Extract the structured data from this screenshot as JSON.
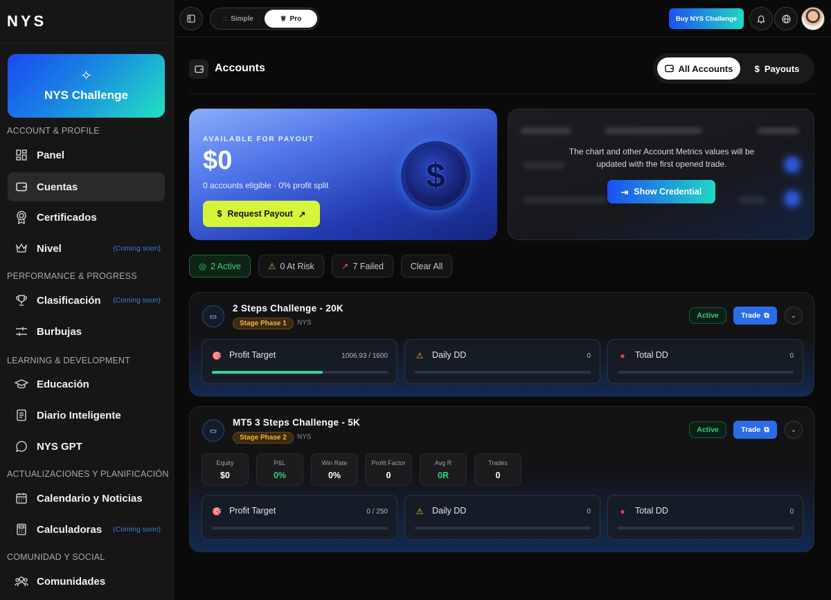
{
  "brand": {
    "logo": "NYS",
    "challenge_card": "NYS Challenge"
  },
  "sidebar": {
    "sections": [
      {
        "label": "ACCOUNT & PROFILE"
      },
      {
        "label": "PERFORMANCE & PROGRESS"
      },
      {
        "label": "LEARNING & DEVELOPMENT"
      },
      {
        "label": "ACTUALIZACIONES Y PLANIFICACIÓN"
      },
      {
        "label": "COMUNIDAD Y SOCIAL"
      }
    ],
    "items": [
      {
        "label": "Panel"
      },
      {
        "label": "Cuentas",
        "active": true
      },
      {
        "label": "Certificados"
      },
      {
        "label": "Nivel",
        "badge": "(Coming soon)"
      },
      {
        "label": "Clasificación",
        "badge": "(Coming soon)"
      },
      {
        "label": "Burbujas"
      },
      {
        "label": "Educación"
      },
      {
        "label": "Diario Inteligente"
      },
      {
        "label": "NYS GPT"
      },
      {
        "label": "Calendario y Noticias"
      },
      {
        "label": "Calculadoras",
        "badge": "(Coming soon)"
      },
      {
        "label": "Comunidades"
      }
    ]
  },
  "topbar": {
    "mode_simple": "Simple",
    "mode_pro": "Pro",
    "active_mode": "Pro",
    "buy_button": "Buy NYS Challenge"
  },
  "accounts_header": {
    "title": "Accounts",
    "tab_all": "All Accounts",
    "tab_payouts": "Payouts",
    "active_tab": "All Accounts"
  },
  "payout": {
    "kicker": "AVAILABLE FOR PAYOUT",
    "amount": "$0",
    "sub": "0 accounts eligible · 0% profit split",
    "button": "Request Payout"
  },
  "metrics_notice": {
    "message": "The chart and other Account Metrics values will be updated with the first opened trade.",
    "button": "Show Credential"
  },
  "filters": [
    {
      "label": "2 Active",
      "active": true
    },
    {
      "label": "0 At Risk"
    },
    {
      "label": "7 Failed"
    },
    {
      "label": "Clear All"
    }
  ],
  "accounts": [
    {
      "name": "2 Steps Challenge - 20K",
      "stage": "Stage Phase 1",
      "firm": "NYS",
      "status": "Active",
      "trade": "Trade",
      "metrics": [
        {
          "label": "Profit Target",
          "value": "1006.93 / 1600",
          "progress": 0.63
        },
        {
          "label": "Daily DD",
          "value": "0",
          "progress": 0
        },
        {
          "label": "Total DD",
          "value": "0",
          "progress": 0
        }
      ]
    },
    {
      "name": "MT5 3 Steps Challenge - 5K",
      "stage": "Stage Phase 2",
      "firm": "NYS",
      "status": "Active",
      "trade": "Trade",
      "stats": [
        {
          "label": "Equity",
          "value": "$0"
        },
        {
          "label": "P&L",
          "value": "0%"
        },
        {
          "label": "Win Rate",
          "value": "0%"
        },
        {
          "label": "Profit Factor",
          "value": "0"
        },
        {
          "label": "Avg R",
          "value": "0R"
        },
        {
          "label": "Trades",
          "value": "0"
        }
      ],
      "metrics": [
        {
          "label": "Profit Target",
          "value": "0 / 250",
          "progress": 0
        },
        {
          "label": "Daily DD",
          "value": "0",
          "progress": 0
        },
        {
          "label": "Total DD",
          "value": "0",
          "progress": 0
        }
      ]
    }
  ],
  "colors": {
    "accent_blue": "#1c4ff2",
    "accent_teal": "#20d8c4",
    "active_green": "#34d27b",
    "lime": "#d6f53a",
    "stage_amber": "#f5b63b"
  }
}
